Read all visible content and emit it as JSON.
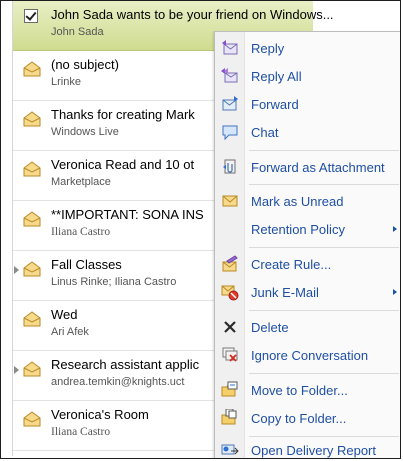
{
  "messages": [
    {
      "title": "John Sada wants to be your friend on Windows...",
      "sender": "John Sada",
      "selected": true,
      "icon": "checkbox-checked-icon"
    },
    {
      "title": "(no subject)",
      "sender": "Lrinke",
      "icon": "envelope-open-icon"
    },
    {
      "title": "Thanks for creating Mark",
      "sender": "Windows Live",
      "icon": "envelope-open-icon"
    },
    {
      "title": "Veronica Read and 10 ot",
      "sender": "Marketplace",
      "icon": "envelope-open-icon"
    },
    {
      "title": "**IMPORTANT: SONA INS",
      "sender": "Iliana Castro",
      "icon": "envelope-open-icon"
    },
    {
      "title": "Fall Classes",
      "sender": "Linus Rinke; Iliana Castro",
      "icon": "conversation-icon",
      "expandable": true
    },
    {
      "title": "Wed",
      "sender": "Ari Afek",
      "icon": "envelope-open-icon"
    },
    {
      "title": "Research assistant applic",
      "sender": "andrea.temkin@knights.uct",
      "icon": "conversation-icon",
      "expandable": true
    },
    {
      "title": "Veronica's Room",
      "sender": "Iliana Castro",
      "icon": "envelope-open-icon"
    }
  ],
  "context_menu": {
    "items": [
      {
        "label": "Reply",
        "icon": "reply-icon"
      },
      {
        "label": "Reply All",
        "icon": "reply-all-icon"
      },
      {
        "label": "Forward",
        "icon": "forward-icon"
      },
      {
        "label": "Chat",
        "icon": "chat-icon"
      },
      {
        "label": "Forward as Attachment",
        "icon": "forward-attachment-icon"
      },
      {
        "label": "Mark as Unread",
        "icon": "mark-unread-icon"
      },
      {
        "label": "Retention Policy",
        "icon": "",
        "submenu": true
      },
      {
        "label": "Create Rule...",
        "icon": "create-rule-icon"
      },
      {
        "label": "Junk E-Mail",
        "icon": "junk-mail-icon",
        "submenu": true
      },
      {
        "label": "Delete",
        "icon": "delete-icon"
      },
      {
        "label": "Ignore Conversation",
        "icon": "ignore-conversation-icon"
      },
      {
        "label": "Move to Folder...",
        "icon": "move-folder-icon"
      },
      {
        "label": "Copy to Folder...",
        "icon": "copy-folder-icon"
      },
      {
        "label": "Open Delivery Report",
        "icon": "delivery-report-icon"
      }
    ]
  },
  "colors": {
    "selection": "#d9e5a8",
    "menu_text": "#1f4fa3",
    "envelope": "#e8b94a"
  }
}
